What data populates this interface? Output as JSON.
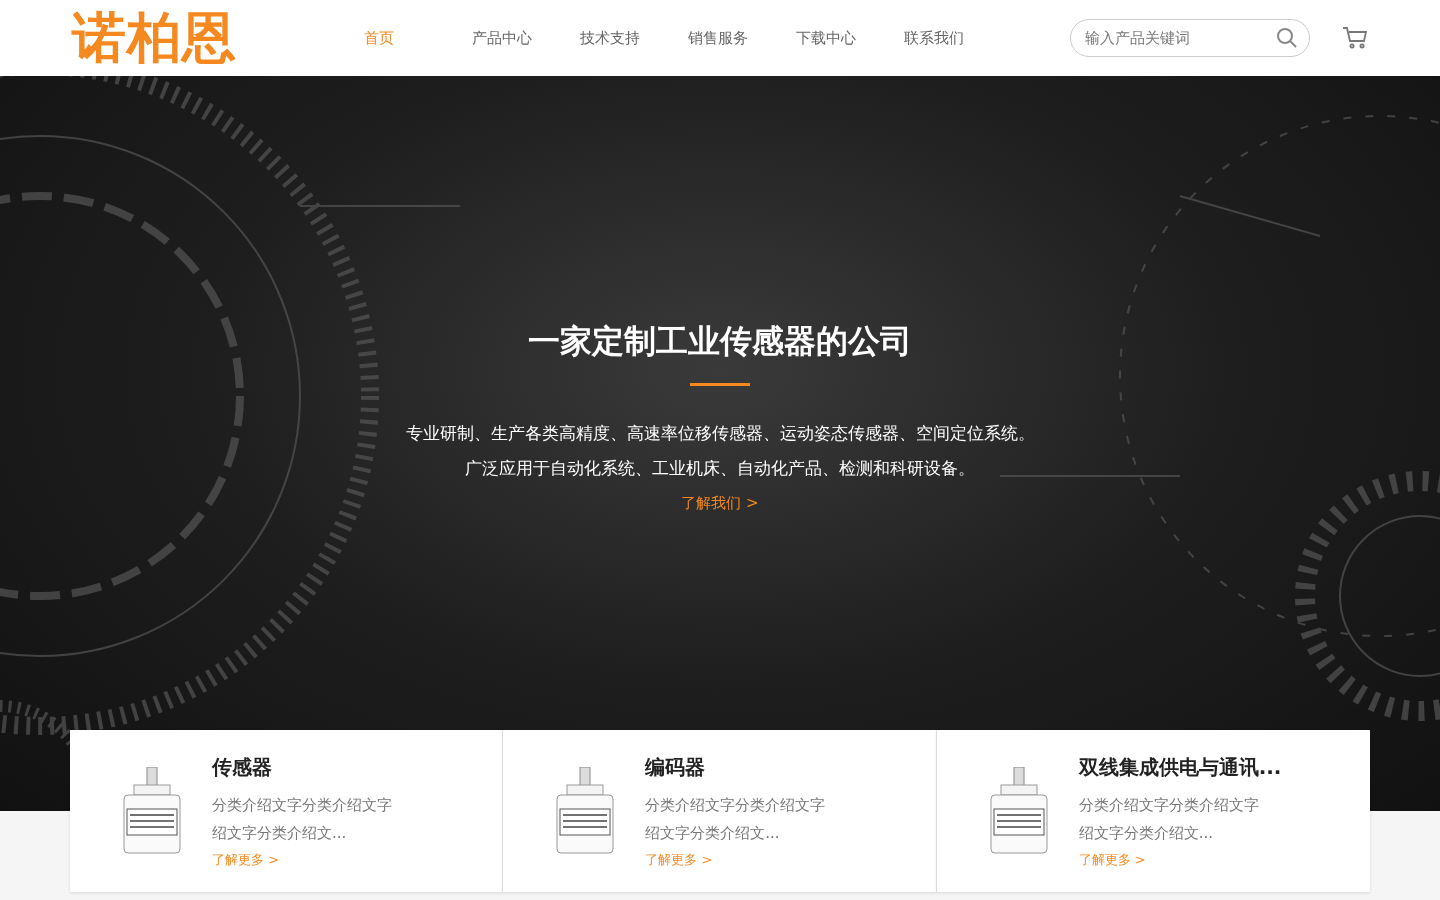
{
  "header": {
    "logo": "诺柏恩",
    "nav": [
      {
        "label": "首页",
        "selected": true
      },
      {
        "label": "产品中心",
        "selected": false
      },
      {
        "label": "技术支持",
        "selected": false
      },
      {
        "label": "销售服务",
        "selected": false
      },
      {
        "label": "下载中心",
        "selected": false
      },
      {
        "label": "联系我们",
        "selected": false
      }
    ],
    "search": {
      "placeholder": "输入产品关键词"
    }
  },
  "hero": {
    "title": "一家定制工业传感器的公司",
    "lines": [
      "专业研制、生产各类高精度、高速率位移传感器、运动姿态传感器、空间定位系统。",
      "广泛应用于自动化系统、工业机床、自动化产品、检测和科研设备。"
    ],
    "link": "了解我们 >"
  },
  "categories": [
    {
      "title": "传感器",
      "description": "分类介绍文字分类介绍文字绍文字分类介绍文...",
      "link": "了解更多 >"
    },
    {
      "title": "编码器",
      "description": "分类介绍文字分类介绍文字绍文字分类介绍文...",
      "link": "了解更多 >"
    },
    {
      "title": "双线集成供电与通讯...",
      "description": "分类介绍文字分类介绍文字绍文字分类介绍文...",
      "link": "了解更多 >"
    }
  ]
}
